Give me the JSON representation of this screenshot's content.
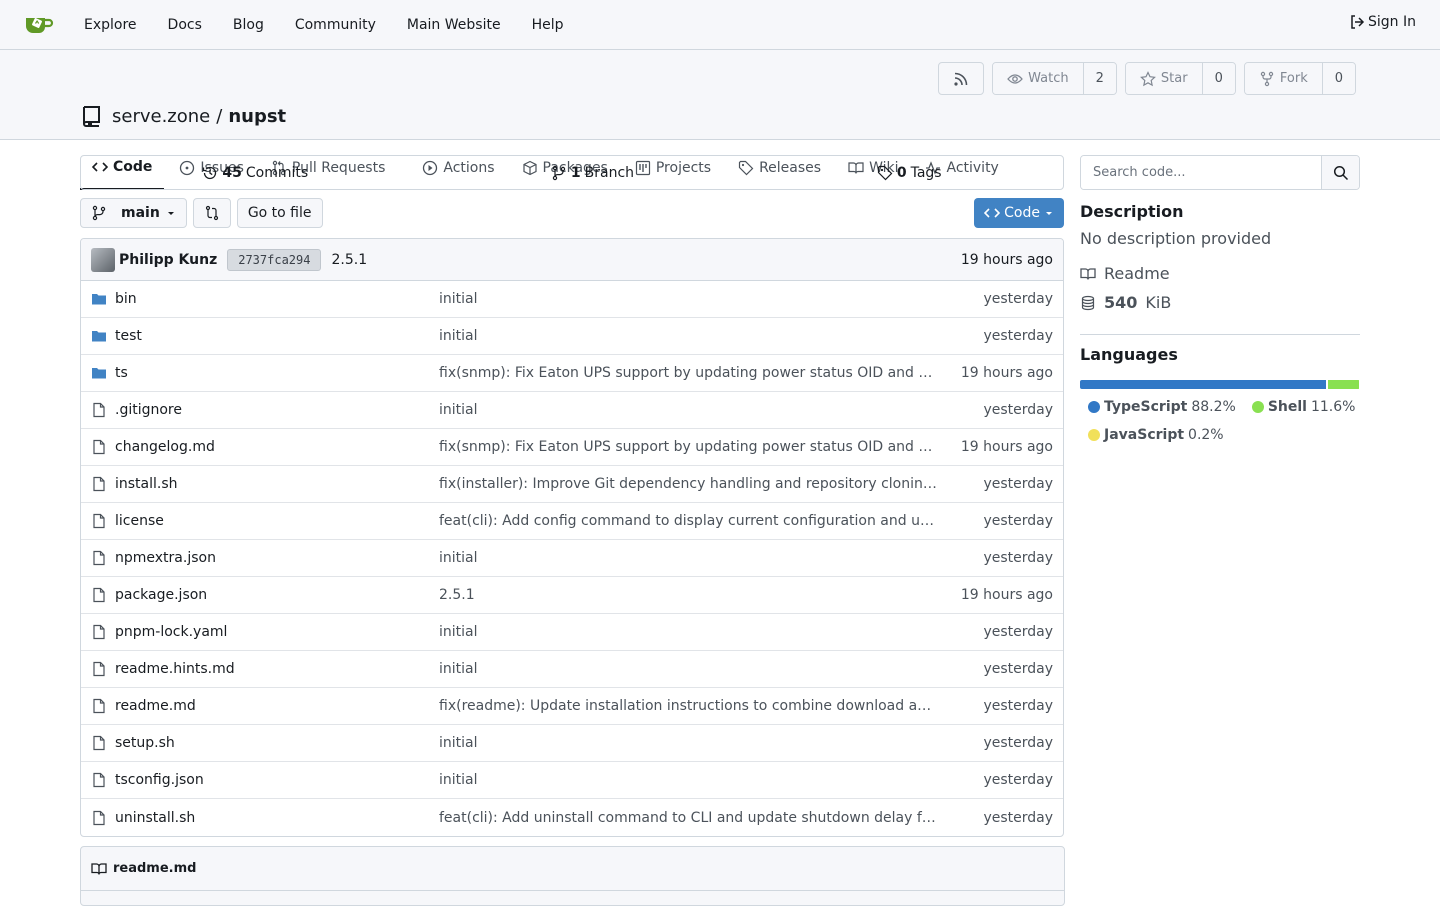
{
  "nav": {
    "links": [
      "Explore",
      "Docs",
      "Blog",
      "Community",
      "Main Website",
      "Help"
    ],
    "signin": "Sign In"
  },
  "repo": {
    "owner": "serve.zone",
    "separator": "/",
    "name": "nupst",
    "watch_label": "Watch",
    "watch_count": "2",
    "star_label": "Star",
    "star_count": "0",
    "fork_label": "Fork",
    "fork_count": "0"
  },
  "tabs": [
    "Code",
    "Issues",
    "Pull Requests",
    "Actions",
    "Packages",
    "Projects",
    "Releases",
    "Wiki",
    "Activity"
  ],
  "stats": {
    "commits_count": "45",
    "commits_label": "Commits",
    "branches_count": "1",
    "branches_label": "Branch",
    "tags_count": "0",
    "tags_label": "Tags"
  },
  "branch": {
    "name": "main",
    "goto_label": "Go to file",
    "code_label": "Code"
  },
  "latest_commit": {
    "author": "Philipp Kunz",
    "sha": "2737fca294",
    "message": "2.5.1",
    "time": "19 hours ago"
  },
  "files": [
    {
      "name": "bin",
      "type": "dir",
      "message": "initial",
      "time": "yesterday"
    },
    {
      "name": "test",
      "type": "dir",
      "message": "initial",
      "time": "yesterday"
    },
    {
      "name": "ts",
      "type": "dir",
      "message": "fix(snmp): Fix Eaton UPS support by updating power status OID and …",
      "time": "19 hours ago"
    },
    {
      "name": ".gitignore",
      "type": "file",
      "message": "initial",
      "time": "yesterday"
    },
    {
      "name": "changelog.md",
      "type": "file",
      "message": "fix(snmp): Fix Eaton UPS support by updating power status OID and …",
      "time": "19 hours ago"
    },
    {
      "name": "install.sh",
      "type": "file",
      "message": "fix(installer): Improve Git dependency handling and repository clonin…",
      "time": "yesterday"
    },
    {
      "name": "license",
      "type": "file",
      "message": "feat(cli): Add config command to display current configuration and u…",
      "time": "yesterday"
    },
    {
      "name": "npmextra.json",
      "type": "file",
      "message": "initial",
      "time": "yesterday"
    },
    {
      "name": "package.json",
      "type": "file",
      "message": "2.5.1",
      "time": "19 hours ago"
    },
    {
      "name": "pnpm-lock.yaml",
      "type": "file",
      "message": "initial",
      "time": "yesterday"
    },
    {
      "name": "readme.hints.md",
      "type": "file",
      "message": "initial",
      "time": "yesterday"
    },
    {
      "name": "readme.md",
      "type": "file",
      "message": "fix(readme): Update installation instructions to combine download an…",
      "time": "yesterday"
    },
    {
      "name": "setup.sh",
      "type": "file",
      "message": "initial",
      "time": "yesterday"
    },
    {
      "name": "tsconfig.json",
      "type": "file",
      "message": "initial",
      "time": "yesterday"
    },
    {
      "name": "uninstall.sh",
      "type": "file",
      "message": "feat(cli): Add uninstall command to CLI and update shutdown delay f…",
      "time": "yesterday"
    }
  ],
  "readme": {
    "title": "readme.md"
  },
  "sidebar": {
    "search_placeholder": "Search code...",
    "description_heading": "Description",
    "description_text": "No description provided",
    "readme_label": "Readme",
    "size_value": "540",
    "size_unit": "KiB",
    "languages_heading": "Languages",
    "languages": [
      {
        "name": "TypeScript",
        "percent": "88.2%",
        "color": "#3178c6"
      },
      {
        "name": "Shell",
        "percent": "11.6%",
        "color": "#89e051"
      },
      {
        "name": "JavaScript",
        "percent": "0.2%",
        "color": "#f1e05a"
      }
    ]
  }
}
